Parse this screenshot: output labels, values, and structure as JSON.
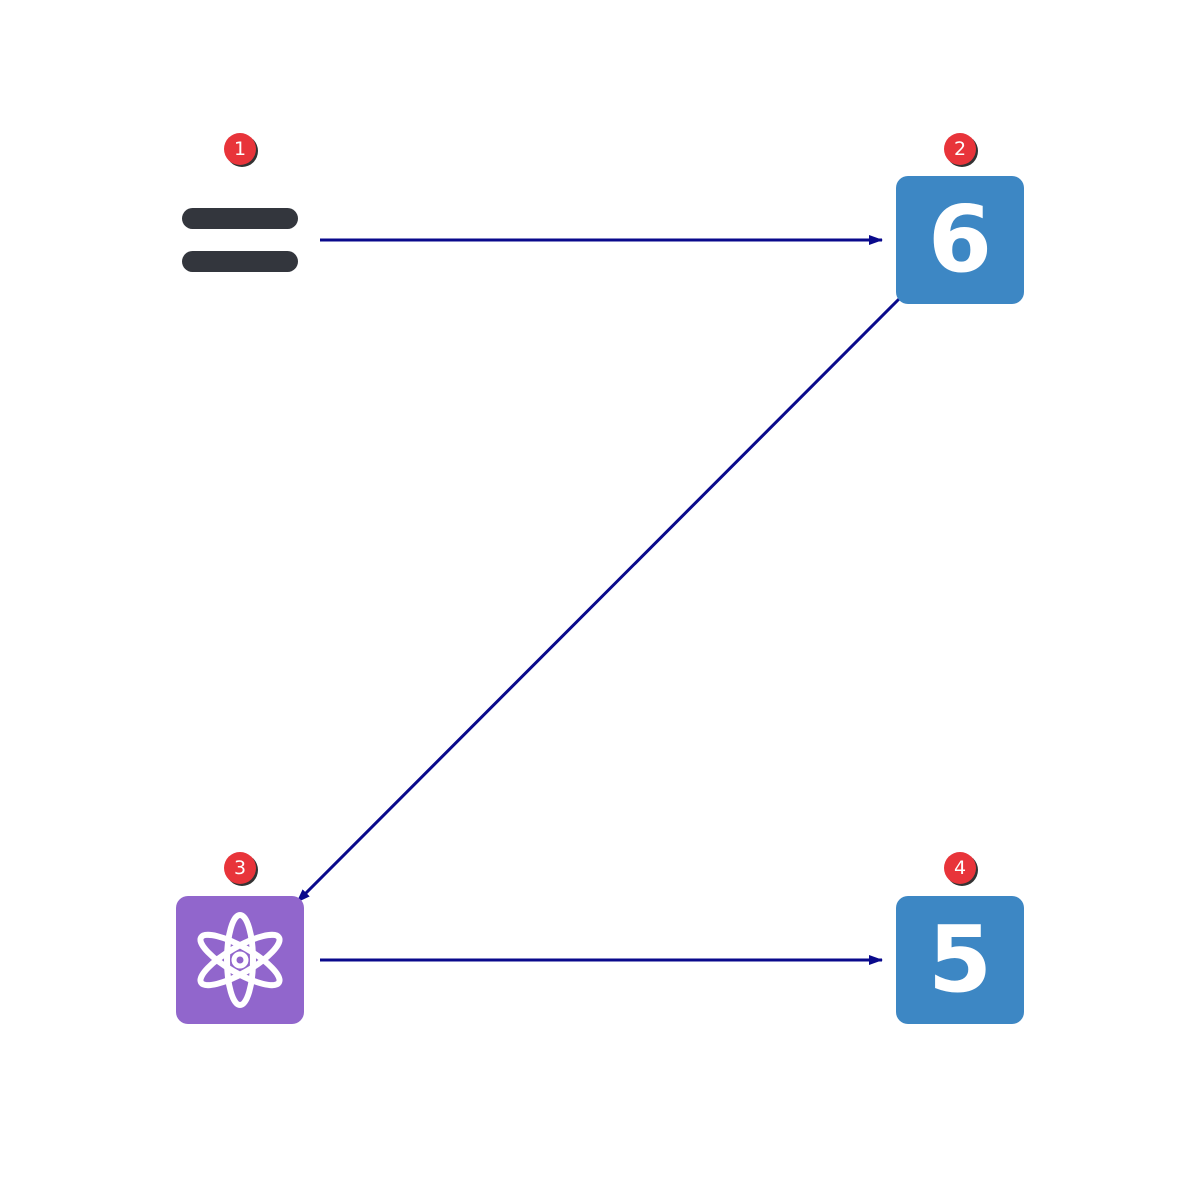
{
  "colors": {
    "arrow": "#0a0a8c",
    "badge": "#e8343a",
    "number_tile": "#3d87c4",
    "atom_tile": "#9166cc",
    "menu_icon": "#33363d",
    "tile_glyph": "#ffffff"
  },
  "nodes": [
    {
      "id": "n1",
      "badge": "1",
      "icon": "menu-icon"
    },
    {
      "id": "n2",
      "badge": "2",
      "icon": "number-6-icon",
      "glyph": "6"
    },
    {
      "id": "n3",
      "badge": "3",
      "icon": "atom-icon"
    },
    {
      "id": "n4",
      "badge": "4",
      "icon": "number-5-icon",
      "glyph": "5"
    }
  ],
  "edges": [
    {
      "from": "n1",
      "to": "n2"
    },
    {
      "from": "n2",
      "to": "n3"
    },
    {
      "from": "n3",
      "to": "n4"
    }
  ]
}
